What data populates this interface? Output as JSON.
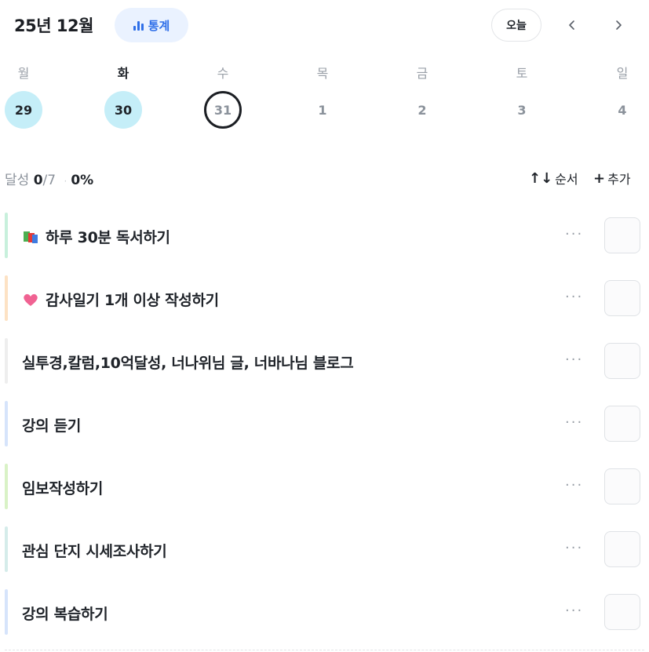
{
  "header": {
    "month_title": "25년 12월",
    "stats_label": "통계",
    "today_label": "오늘",
    "prev_icon": "chevron-left-icon",
    "next_icon": "chevron-right-icon"
  },
  "week": [
    {
      "name": "월",
      "num": "29",
      "state": "done"
    },
    {
      "name": "화",
      "num": "30",
      "state": "done"
    },
    {
      "name": "수",
      "num": "31",
      "state": "today"
    },
    {
      "name": "목",
      "num": "1",
      "state": "future"
    },
    {
      "name": "금",
      "num": "2",
      "state": "future"
    },
    {
      "name": "토",
      "num": "3",
      "state": "future"
    },
    {
      "name": "일",
      "num": "4",
      "state": "future"
    }
  ],
  "summary": {
    "label": "달성",
    "done": "0",
    "total": "/7",
    "separator": "·",
    "percent": "0%",
    "sort_label": "순서",
    "add_label": "추가"
  },
  "tasks": [
    {
      "label": "하루 30분 독서하기",
      "icon": "books-icon",
      "bar_color": "#c8f0dc",
      "more": "···"
    },
    {
      "label": "감사일기 1개 이상 작성하기",
      "icon": "heart-icon",
      "bar_color": "#fde2c4",
      "more": "···"
    },
    {
      "label": "실투경,칼럼,10억달성, 너나위님 글, 너바나님 블로그",
      "icon": "",
      "bar_color": "#eeeeee",
      "more": "···"
    },
    {
      "label": "강의 듣기",
      "icon": "",
      "bar_color": "#d6e4fb",
      "more": "···"
    },
    {
      "label": "임보작성하기",
      "icon": "",
      "bar_color": "#d9f2c6",
      "more": "···"
    },
    {
      "label": "관심 단지 시세조사하기",
      "icon": "",
      "bar_color": "#d5ecea",
      "more": "···"
    },
    {
      "label": "강의 복습하기",
      "icon": "",
      "bar_color": "#d6e4fb",
      "more": "···"
    }
  ]
}
